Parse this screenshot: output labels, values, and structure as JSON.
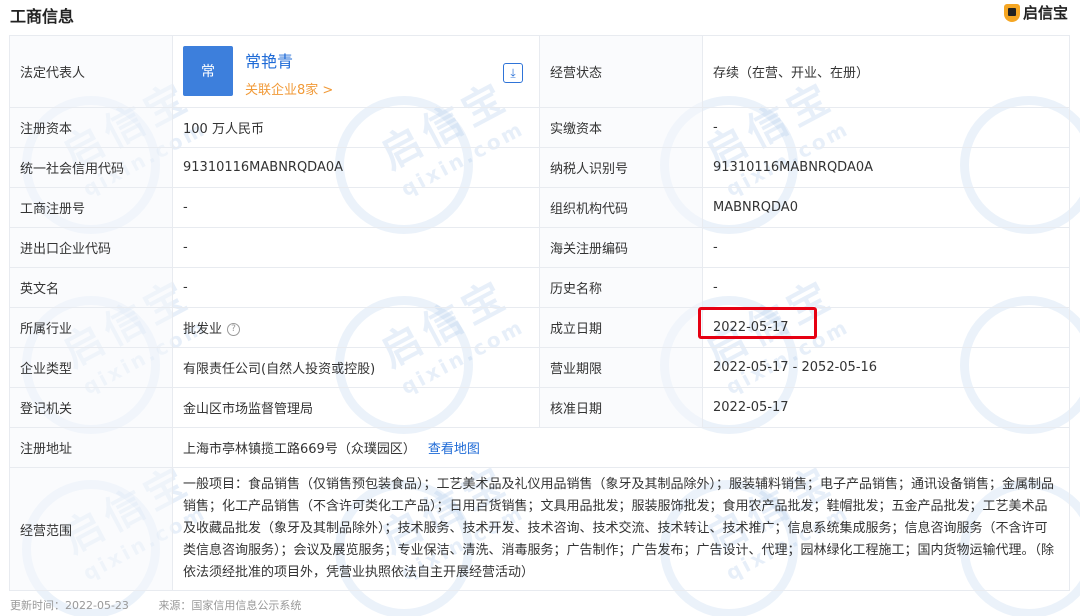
{
  "header": {
    "title": "工商信息",
    "brand": "启信宝"
  },
  "watermark": {
    "text": "启信宝",
    "subtext": "qixin.com"
  },
  "legal_rep": {
    "label": "法定代表人",
    "avatar_text": "常",
    "name": "常艳青",
    "related_link": "关联企业8家 >"
  },
  "rows": {
    "biz_status": {
      "label": "经营状态",
      "value": "存续（在营、开业、在册）"
    },
    "reg_capital": {
      "label": "注册资本",
      "value": "100 万人民币"
    },
    "paid_capital": {
      "label": "实缴资本",
      "value": "-"
    },
    "credit_code": {
      "label": "统一社会信用代码",
      "value": "91310116MABNRQDA0A"
    },
    "taxpayer_id": {
      "label": "纳税人识别号",
      "value": "91310116MABNRQDA0A"
    },
    "reg_no": {
      "label": "工商注册号",
      "value": "-"
    },
    "org_code": {
      "label": "组织机构代码",
      "value": "MABNRQDA0"
    },
    "import_export": {
      "label": "进出口企业代码",
      "value": "-"
    },
    "customs_code": {
      "label": "海关注册编码",
      "value": "-"
    },
    "english_name": {
      "label": "英文名",
      "value": "-"
    },
    "former_name": {
      "label": "历史名称",
      "value": "-"
    },
    "industry": {
      "label": "所属行业",
      "value": "批发业",
      "hint": "?"
    },
    "founded": {
      "label": "成立日期",
      "value": "2022-05-17"
    },
    "company_type": {
      "label": "企业类型",
      "value": "有限责任公司(自然人投资或控股)"
    },
    "biz_term": {
      "label": "营业期限",
      "value": "2022-05-17 - 2052-05-16"
    },
    "reg_authority": {
      "label": "登记机关",
      "value": "金山区市场监督管理局"
    },
    "approved": {
      "label": "核准日期",
      "value": "2022-05-17"
    },
    "address": {
      "label": "注册地址",
      "value": "上海市亭林镇揽工路669号（众璞园区）",
      "map_link": "查看地图"
    },
    "scope": {
      "label": "经营范围",
      "value": "一般项目：食品销售（仅销售预包装食品）；工艺美术品及礼仪用品销售（象牙及其制品除外）；服装辅料销售；电子产品销售；通讯设备销售；金属制品销售；化工产品销售（不含许可类化工产品）；日用百货销售；文具用品批发；服装服饰批发；食用农产品批发；鞋帽批发；五金产品批发；工艺美术品及收藏品批发（象牙及其制品除外）；技术服务、技术开发、技术咨询、技术交流、技术转让、技术推广；信息系统集成服务；信息咨询服务（不含许可类信息咨询服务）；会议及展览服务；专业保洁、清洗、消毒服务；广告制作；广告发布；广告设计、代理；园林绿化工程施工；国内货物运输代理。（除依法须经批准的项目外，凭营业执照依法自主开展经营活动）"
    }
  },
  "footer": {
    "updated": "更新时间：2022-05-23",
    "source": "来源：国家信用信息公示系统"
  }
}
